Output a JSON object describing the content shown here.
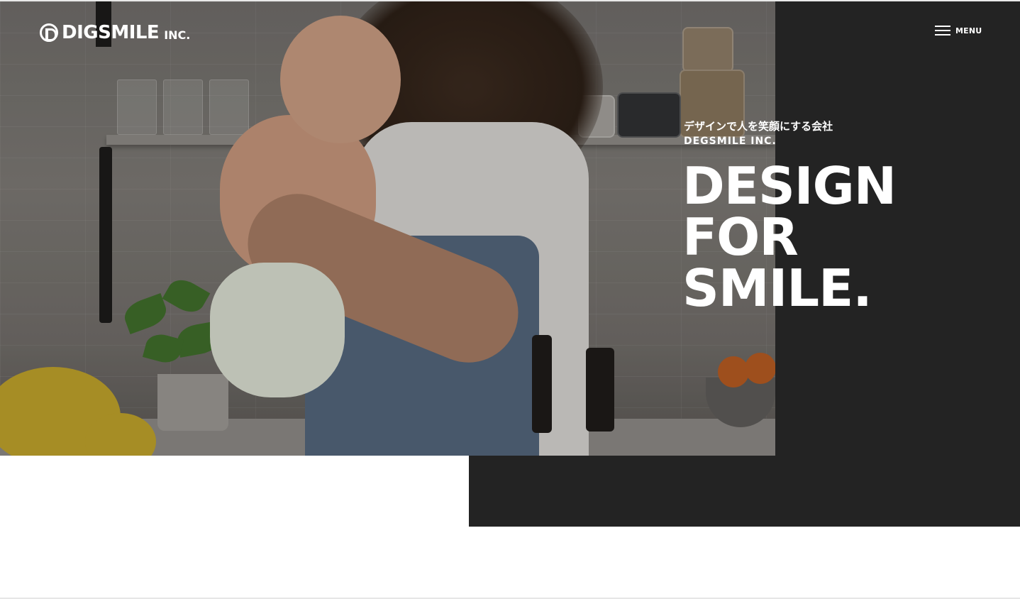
{
  "header": {
    "logo_name": "DIGSMILE",
    "logo_suffix": "INC.",
    "menu_label": "MENU"
  },
  "hero": {
    "tagline_jp": "デザインで人を笑顔にする会社",
    "tagline_en": "DEGSMILE INC.",
    "headline": [
      "DESIGN",
      "FOR",
      "SMILE."
    ]
  },
  "colors": {
    "dark_panel": "#232323",
    "text": "#ffffff",
    "page_background": "#ffffff"
  },
  "icons": [
    "logo-d-icon",
    "hamburger-icon"
  ]
}
